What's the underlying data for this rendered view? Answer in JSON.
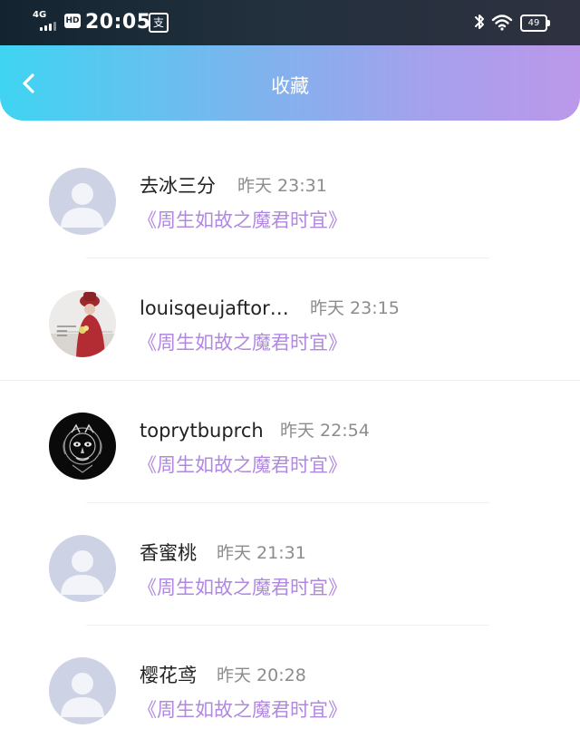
{
  "status_bar": {
    "network": "4G",
    "hd": "HD",
    "time": "20:05",
    "pay_icon": "支",
    "battery": "49"
  },
  "header": {
    "title": "收藏",
    "back_icon": "chevron-left-icon"
  },
  "items": [
    {
      "user": "去冰三分",
      "time": "昨天 23:31",
      "link": "《周生如故之魔君时宜》",
      "avatar": "default"
    },
    {
      "user": "louisqeujaftor…",
      "time": "昨天 23:15",
      "link": "《周生如故之魔君时宜》",
      "avatar": "red-figure"
    },
    {
      "user": "toprytbuprch",
      "time": "昨天 22:54",
      "link": "《周生如故之魔君时宜》",
      "avatar": "dark-mask"
    },
    {
      "user": "香蜜桃",
      "time": "昨天 21:31",
      "link": "《周生如故之魔君时宜》",
      "avatar": "default"
    },
    {
      "user": "樱花鸢",
      "time": "昨天 20:28",
      "link": "《周生如故之魔君时宜》",
      "avatar": "default"
    }
  ],
  "colors": {
    "header_start": "#3fd4f2",
    "header_end": "#bb98ea",
    "link": "#b088e0"
  }
}
